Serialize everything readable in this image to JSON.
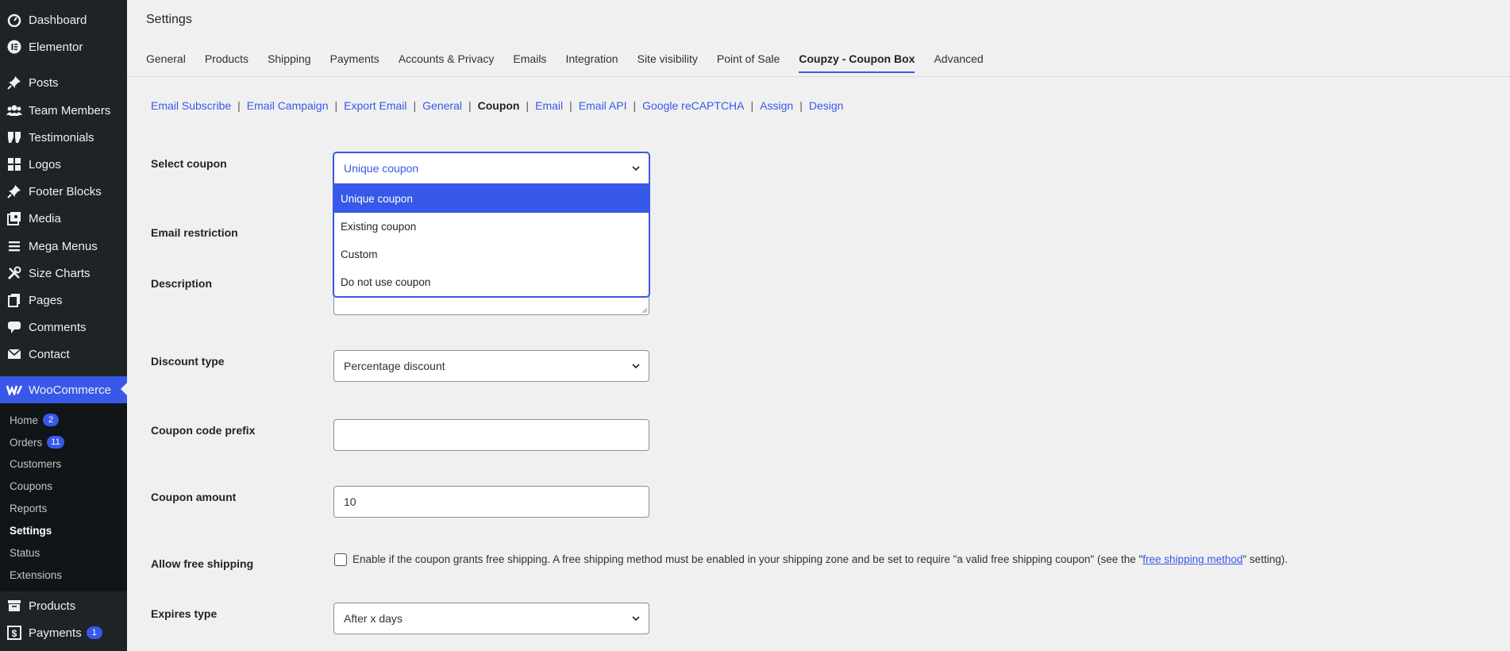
{
  "sidebar": {
    "items": [
      {
        "label": "Dashboard",
        "icon": "dashboard-icon"
      },
      {
        "label": "Elementor",
        "icon": "elementor-icon"
      },
      {
        "label": "Posts",
        "icon": "pin-icon"
      },
      {
        "label": "Team Members",
        "icon": "users-icon"
      },
      {
        "label": "Testimonials",
        "icon": "quote-icon"
      },
      {
        "label": "Logos",
        "icon": "grid-icon"
      },
      {
        "label": "Footer Blocks",
        "icon": "pin-icon"
      },
      {
        "label": "Media",
        "icon": "media-icon"
      },
      {
        "label": "Mega Menus",
        "icon": "menu-icon"
      },
      {
        "label": "Size Charts",
        "icon": "tools-icon"
      },
      {
        "label": "Pages",
        "icon": "pages-icon"
      },
      {
        "label": "Comments",
        "icon": "comment-icon"
      },
      {
        "label": "Contact",
        "icon": "mail-icon"
      },
      {
        "label": "WooCommerce",
        "icon": "woo-icon"
      }
    ],
    "submenu": [
      {
        "label": "Home",
        "badge": "2"
      },
      {
        "label": "Orders",
        "badge": "11"
      },
      {
        "label": "Customers",
        "badge": ""
      },
      {
        "label": "Coupons",
        "badge": ""
      },
      {
        "label": "Reports",
        "badge": ""
      },
      {
        "label": "Settings",
        "badge": ""
      },
      {
        "label": "Status",
        "badge": ""
      },
      {
        "label": "Extensions",
        "badge": ""
      }
    ],
    "bottom": [
      {
        "label": "Products",
        "icon": "archive-icon",
        "badge": ""
      },
      {
        "label": "Payments",
        "icon": "dollar-icon",
        "badge": "1"
      }
    ]
  },
  "header": {
    "title": "Settings"
  },
  "tabs": [
    "General",
    "Products",
    "Shipping",
    "Payments",
    "Accounts & Privacy",
    "Emails",
    "Integration",
    "Site visibility",
    "Point of Sale",
    "Coupzy - Coupon Box",
    "Advanced"
  ],
  "active_tab": "Coupzy - Coupon Box",
  "subnav": [
    "Email Subscribe",
    "Email Campaign",
    "Export Email",
    "General",
    "Coupon",
    "Email",
    "Email API",
    "Google reCAPTCHA",
    "Assign",
    "Design"
  ],
  "separator": "|",
  "form": {
    "select_coupon": {
      "label": "Select coupon",
      "value": "Unique coupon",
      "options": [
        "Unique coupon",
        "Existing coupon",
        "Custom",
        "Do not use coupon"
      ]
    },
    "email_restriction": {
      "label": "Email restriction"
    },
    "description": {
      "label": "Description"
    },
    "discount_type": {
      "label": "Discount type",
      "value": "Percentage discount"
    },
    "coupon_prefix": {
      "label": "Coupon code prefix",
      "value": ""
    },
    "coupon_amount": {
      "label": "Coupon amount",
      "value": "10"
    },
    "free_shipping": {
      "label": "Allow free shipping",
      "text_before": "Enable if the coupon grants free shipping. A free shipping method must be enabled in your shipping zone and be set to require \"a valid free shipping coupon\" (see the \"",
      "link": "free shipping method",
      "text_after": "\" setting)."
    },
    "expires_type": {
      "label": "Expires type",
      "value": "After x days"
    }
  },
  "colors": {
    "accent": "#3858e9",
    "sidebar_bg": "#1d2327",
    "page_bg": "#f0f0f1"
  }
}
